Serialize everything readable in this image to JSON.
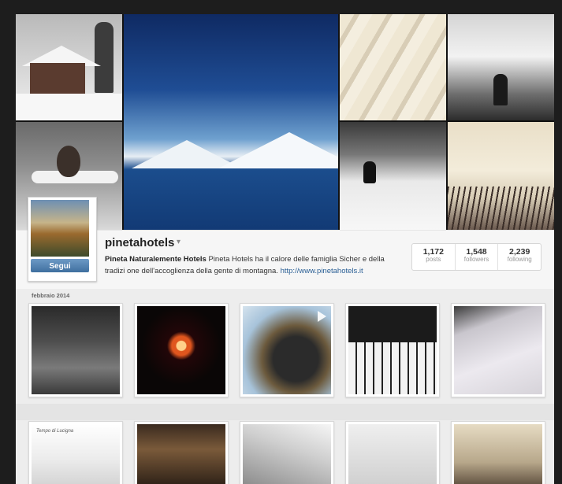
{
  "profile": {
    "username": "pinetahotels",
    "full_name": "Pineta Naturalemente Hotels",
    "bio": "Pineta Hotels ha il calore delle famiglia Sicher e della tradizi one dell'accoglienza della gente di montagna.",
    "website": "http://www.pinetahotels.it",
    "follow_label": "Segui",
    "caret_icon": "chevron-down-icon"
  },
  "stats": [
    {
      "value": "1,172",
      "label": "posts"
    },
    {
      "value": "1,548",
      "label": "followers"
    },
    {
      "value": "2,239",
      "label": "following"
    }
  ],
  "feed": {
    "month_label": "febbraio 2014",
    "row1_caption_3": "",
    "row2_caption_1": "Tempo di Lucigna"
  }
}
